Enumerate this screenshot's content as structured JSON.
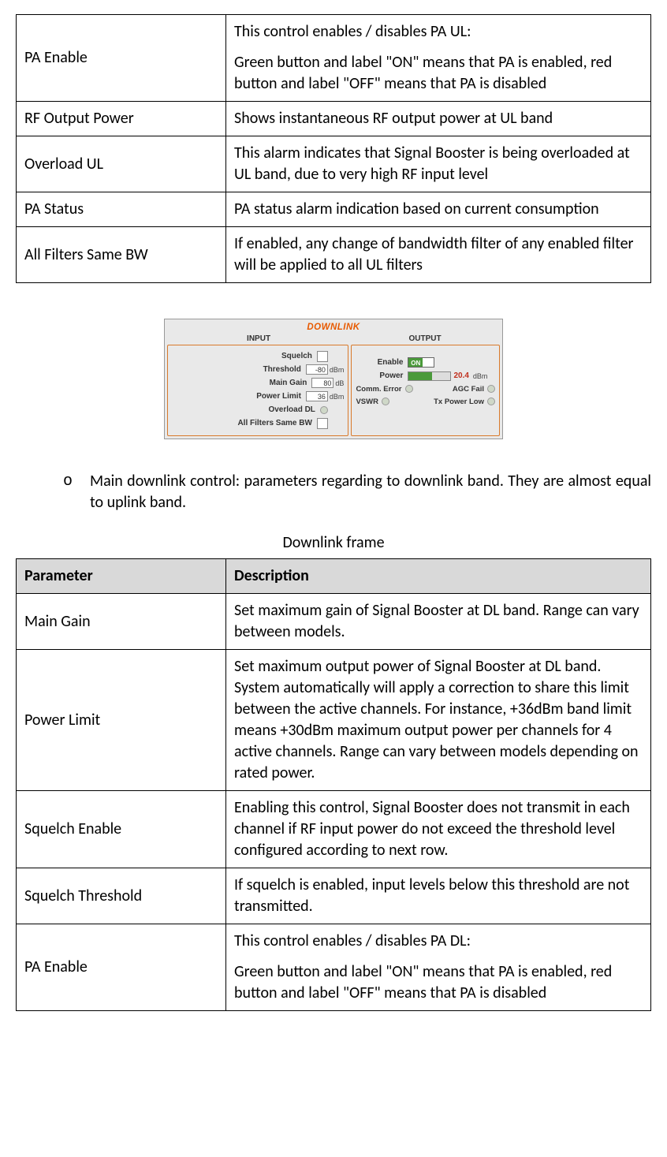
{
  "table1": {
    "rows": [
      {
        "param": "PA Enable",
        "desc": "This control enables / disables PA UL:\nGreen button and label \"ON\" means that PA is enabled, red button and label \"OFF\" means that PA is disabled"
      },
      {
        "param": "RF Output Power",
        "desc": "Shows instantaneous RF output power at UL band"
      },
      {
        "param": "Overload UL",
        "desc": "This alarm indicates that Signal Booster is being overloaded at UL band, due to very high RF input level"
      },
      {
        "param": "PA Status",
        "desc": "PA status alarm indication based on current consumption"
      },
      {
        "param": "All Filters Same BW",
        "desc": "If enabled, any change of bandwidth filter of any enabled filter will be applied to all UL filters"
      }
    ]
  },
  "screenshot": {
    "title": "DOWNLINK",
    "input_label": "INPUT",
    "output_label": "OUTPUT",
    "input": {
      "squelch_label": "Squelch",
      "threshold_label": "Threshold",
      "threshold_value": "-80",
      "threshold_unit": "dBm",
      "main_gain_label": "Main Gain",
      "main_gain_value": "80",
      "main_gain_unit": "dB",
      "power_limit_label": "Power Limit",
      "power_limit_value": "36",
      "power_limit_unit": "dBm",
      "overload_label": "Overload DL",
      "allfilters_label": "All Filters Same BW"
    },
    "output": {
      "enable_label": "Enable",
      "enable_state": "ON",
      "power_label": "Power",
      "power_value": "20.4",
      "power_unit": "dBm",
      "comm_error_label": "Comm. Error",
      "agc_fail_label": "AGC Fail",
      "vswr_label": "VSWR",
      "tx_low_label": "Tx Power Low"
    }
  },
  "bullet": {
    "marker": "o",
    "text": "Main downlink control: parameters regarding to downlink band. They are almost equal to uplink band."
  },
  "caption2": "Downlink frame",
  "table2": {
    "header_param": "Parameter",
    "header_desc": "Description",
    "rows": [
      {
        "param": "Main Gain",
        "desc": "Set maximum gain of Signal Booster at DL band. Range can vary between models."
      },
      {
        "param": "Power Limit",
        "desc": "Set maximum output power of Signal Booster at DL band. System automatically will apply a correction to share this limit between the active channels. For instance, +36dBm band limit means +30dBm maximum output power per channels for 4 active channels. Range can vary between models depending on rated power."
      },
      {
        "param": "Squelch Enable",
        "desc": "Enabling this control, Signal Booster does not transmit in each channel if RF input power do not exceed the threshold level configured according to next row."
      },
      {
        "param": "Squelch Threshold",
        "desc": "If squelch is enabled, input levels below this threshold are not transmitted."
      },
      {
        "param": "PA Enable",
        "desc": "This control enables / disables PA DL:\nGreen button and label \"ON\" means that PA is enabled, red button and label \"OFF\" means that PA is disabled"
      }
    ]
  }
}
